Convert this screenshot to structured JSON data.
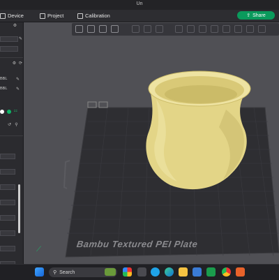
{
  "window": {
    "title": "Un"
  },
  "menu": {
    "tabs": [
      {
        "label": "Device"
      },
      {
        "label": "Project"
      },
      {
        "label": "Calibration"
      }
    ],
    "share_label": "Share"
  },
  "sidebar": {
    "items": [
      {
        "label": "BBL"
      },
      {
        "label": "BBL"
      }
    ]
  },
  "viewport": {
    "plate_label": "Bambu Textured PEI Plate"
  },
  "taskbar": {
    "search_placeholder": "Search"
  },
  "colors": {
    "accent": "#0a9a5c",
    "vase": "#e6d98a",
    "plate": "#2e2e32",
    "background": "#505055"
  },
  "icons": [
    "windows-start-icon",
    "search-icon",
    "file-explorer-icon",
    "edge-icon",
    "chrome-icon",
    "bambu-studio-icon"
  ]
}
